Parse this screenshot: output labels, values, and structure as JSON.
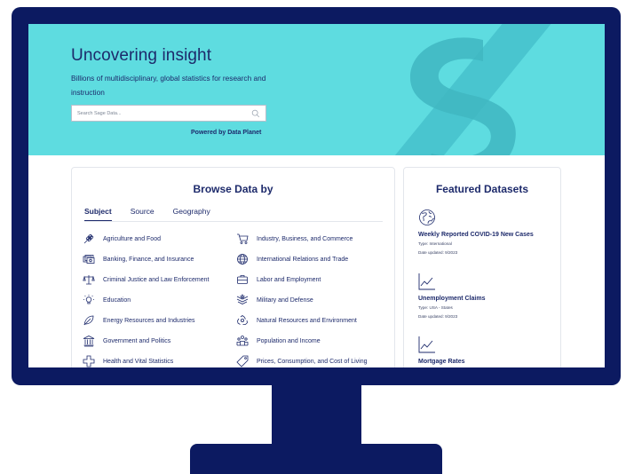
{
  "hero": {
    "title": "Uncovering insight",
    "subtitle": "Billions of multidisciplinary, global statistics for research and instruction",
    "search_placeholder": "Search Sage Data...",
    "powered_by": "Powered by Data Planet",
    "brand_color": "#5edce0"
  },
  "browse": {
    "title": "Browse Data by",
    "tabs": [
      {
        "label": "Subject",
        "active": true
      },
      {
        "label": "Source",
        "active": false
      },
      {
        "label": "Geography",
        "active": false
      }
    ],
    "subjects": [
      {
        "label": "Agriculture and Food",
        "icon": "wheat-icon"
      },
      {
        "label": "Industry, Business, and Commerce",
        "icon": "cart-icon"
      },
      {
        "label": "Banking, Finance, and Insurance",
        "icon": "money-icon"
      },
      {
        "label": "International Relations and Trade",
        "icon": "globe-icon"
      },
      {
        "label": "Criminal Justice and Law Enforcement",
        "icon": "scales-icon"
      },
      {
        "label": "Labor and Employment",
        "icon": "briefcase-icon"
      },
      {
        "label": "Education",
        "icon": "lightbulb-icon"
      },
      {
        "label": "Military and Defense",
        "icon": "insignia-icon"
      },
      {
        "label": "Energy Resources and Industries",
        "icon": "leaf-icon"
      },
      {
        "label": "Natural Resources and Environment",
        "icon": "recycle-icon"
      },
      {
        "label": "Government and Politics",
        "icon": "building-icon"
      },
      {
        "label": "Population and Income",
        "icon": "people-icon"
      },
      {
        "label": "Health and Vital Statistics",
        "icon": "cross-icon"
      },
      {
        "label": "Prices, Consumption, and Cost of Living",
        "icon": "tag-icon"
      }
    ]
  },
  "featured": {
    "title": "Featured Datasets",
    "items": [
      {
        "icon": "globe-icon",
        "title": "Weekly Reported COVID-19 New Cases",
        "type": "Type: International",
        "updated": "Date updated: 9/2023"
      },
      {
        "icon": "line-chart-icon",
        "title": "Unemployment Claims",
        "type": "Type: USA - States",
        "updated": "Date updated: 9/2023"
      },
      {
        "icon": "line-chart-icon",
        "title": "Mortgage Rates",
        "type": "",
        "updated": ""
      }
    ]
  },
  "colors": {
    "frame": "#0c1a61",
    "text": "#1d2a6b"
  }
}
